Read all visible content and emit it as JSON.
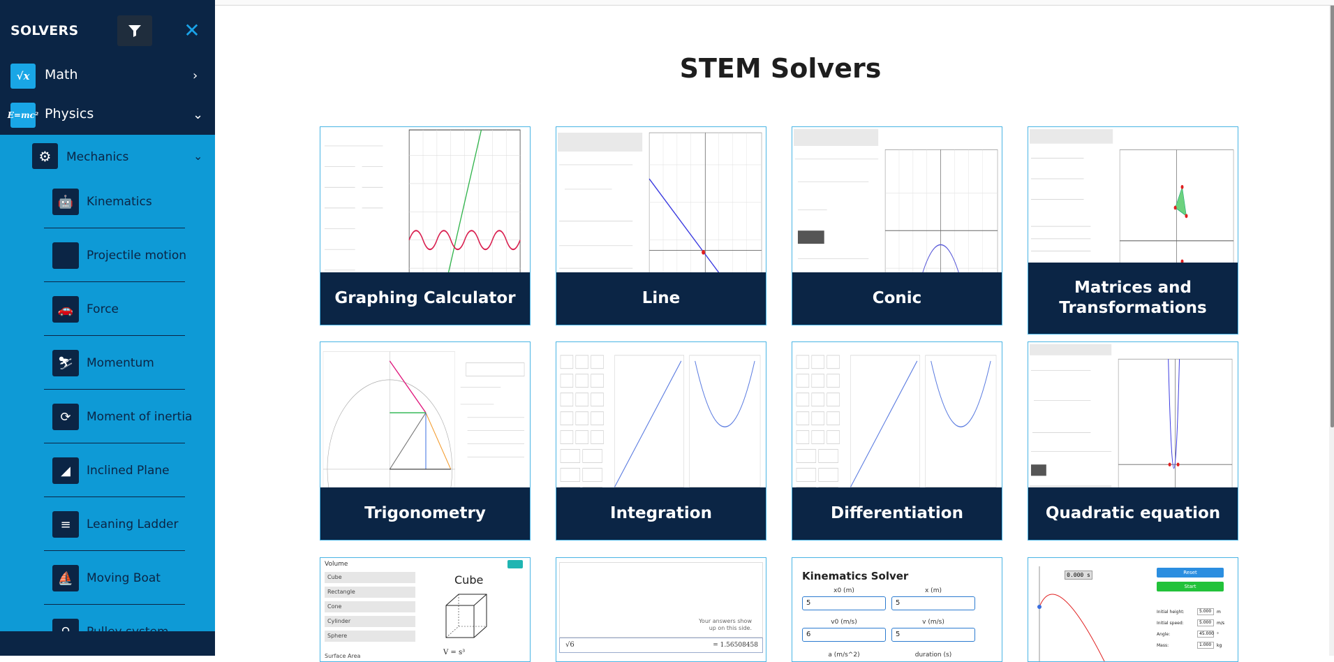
{
  "sidebar": {
    "title": "SOLVERS",
    "categories": [
      {
        "label": "Math",
        "icon": "sqrt-x-icon",
        "icon_text": "√x",
        "chevron": "›"
      },
      {
        "label": "Physics",
        "icon": "emc2-icon",
        "icon_text": "E=mc²",
        "chevron": "⌄"
      }
    ],
    "subcategory": {
      "label": "Mechanics",
      "icon": "gears-icon",
      "chevron": "⌄"
    },
    "items": [
      {
        "label": "Kinematics",
        "icon": "robot-icon"
      },
      {
        "label": "Projectile motion",
        "icon": "projectile-icon"
      },
      {
        "label": "Force",
        "icon": "car-crash-icon"
      },
      {
        "label": "Momentum",
        "icon": "skier-icon"
      },
      {
        "label": "Moment of inertia",
        "icon": "rotation-icon"
      },
      {
        "label": "Inclined Plane",
        "icon": "incline-icon"
      },
      {
        "label": "Leaning Ladder",
        "icon": "ladder-icon"
      },
      {
        "label": "Moving Boat",
        "icon": "boat-icon"
      },
      {
        "label": "Pulley system",
        "icon": "pulley-icon"
      }
    ]
  },
  "main": {
    "title": "STEM Solvers",
    "cards": [
      {
        "label": "Graphing Calculator"
      },
      {
        "label": "Line"
      },
      {
        "label": "Conic"
      },
      {
        "label": "Matrices and Transformations"
      },
      {
        "label": "Trigonometry"
      },
      {
        "label": "Integration"
      },
      {
        "label": "Differentiation"
      },
      {
        "label": "Quadratic equation"
      }
    ],
    "bottom_cards": [
      {
        "heading": "Volume",
        "sub": "Cube",
        "items": [
          "Cube",
          "Rectangle",
          "Cone",
          "Cylinder",
          "Sphere"
        ],
        "formula": "V = s³",
        "footer": "Surface Area"
      },
      {
        "note": "Your answers show up on this side.",
        "input": "√6",
        "result": "= 1.56508458"
      },
      {
        "heading": "Kinematics Solver",
        "fields": [
          {
            "label": "x0 (m)",
            "value": "5"
          },
          {
            "label": "x (m)",
            "value": "5"
          },
          {
            "label": "v0 (m/s)",
            "value": "6"
          },
          {
            "label": "v (m/s)",
            "value": "5"
          },
          {
            "label": "a (m/s^2)",
            "value": ""
          },
          {
            "label": "duration (s)",
            "value": ""
          }
        ]
      },
      {
        "timer": "0.000 s",
        "buttons": [
          "Reset",
          "Start"
        ],
        "params": [
          {
            "label": "Initial height:",
            "value": "5.000",
            "unit": "m"
          },
          {
            "label": "Initial speed:",
            "value": "5.000",
            "unit": "m/s"
          },
          {
            "label": "Angle:",
            "value": "45.000",
            "unit": "°"
          },
          {
            "label": "Mass:",
            "value": "1.000",
            "unit": "kg"
          }
        ]
      }
    ]
  },
  "colors": {
    "navy": "#0b2545",
    "sky": "#0e9ad6",
    "accent": "#1aa3e8"
  }
}
